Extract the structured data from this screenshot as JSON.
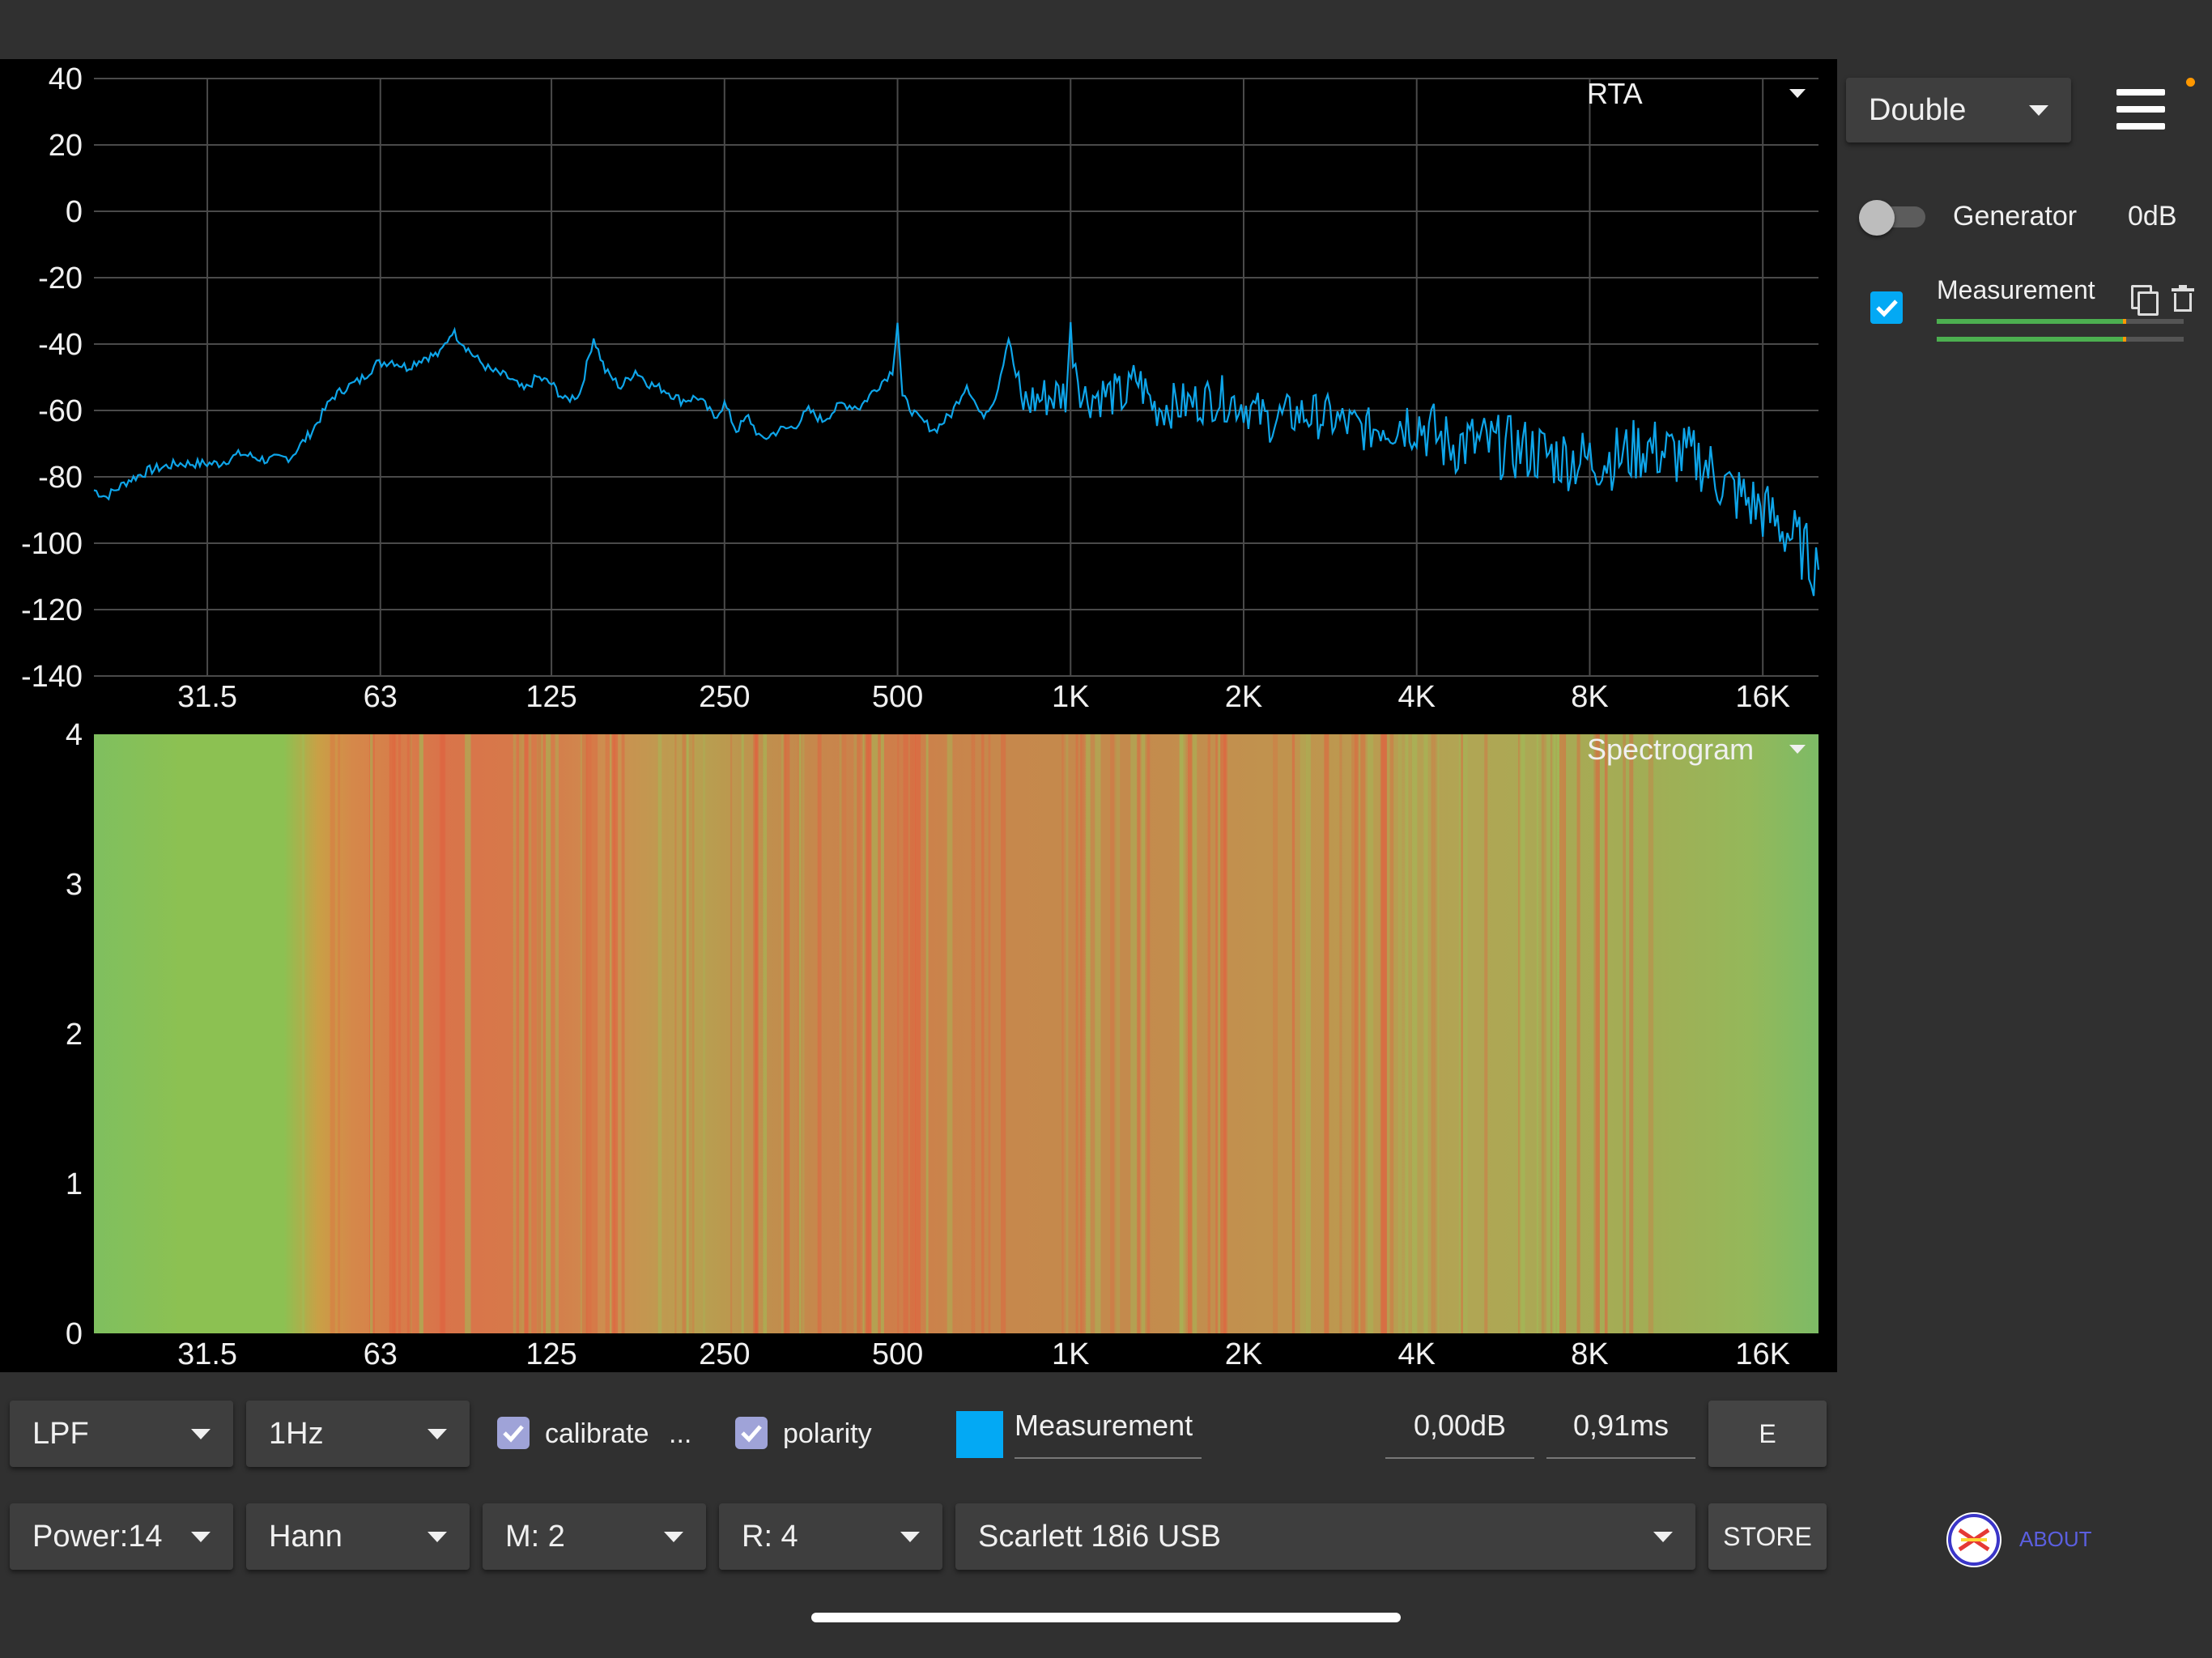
{
  "chart_data": [
    {
      "type": "line",
      "view_label": "RTA",
      "scale": "log-x",
      "x_ticks": [
        "31.5",
        "63",
        "125",
        "250",
        "500",
        "1K",
        "2K",
        "4K",
        "8K",
        "16K"
      ],
      "y_ticks": [
        "40",
        "20",
        "0",
        "-20",
        "-40",
        "-60",
        "-80",
        "-100",
        "-120",
        "-140"
      ],
      "ylim": [
        -140,
        40
      ],
      "xlim_hz": [
        20,
        20000
      ],
      "grid": true,
      "series": [
        {
          "color": "#0ea5e9",
          "points": [
            [
              20,
              -84
            ],
            [
              21,
              -86
            ],
            [
              23,
              -81
            ],
            [
              25,
              -78
            ],
            [
              28,
              -76
            ],
            [
              30,
              -76
            ],
            [
              33,
              -76
            ],
            [
              36,
              -73
            ],
            [
              40,
              -75
            ],
            [
              44,
              -74
            ],
            [
              48,
              -66
            ],
            [
              52,
              -56
            ],
            [
              55,
              -53
            ],
            [
              58,
              -51
            ],
            [
              62,
              -46
            ],
            [
              66,
              -45
            ],
            [
              70,
              -47
            ],
            [
              75,
              -44
            ],
            [
              80,
              -43
            ],
            [
              84,
              -36
            ],
            [
              88,
              -40
            ],
            [
              92,
              -44
            ],
            [
              98,
              -48
            ],
            [
              105,
              -50
            ],
            [
              112,
              -54
            ],
            [
              118,
              -50
            ],
            [
              125,
              -52
            ],
            [
              132,
              -57
            ],
            [
              140,
              -55
            ],
            [
              148,
              -38
            ],
            [
              155,
              -48
            ],
            [
              165,
              -53
            ],
            [
              175,
              -48
            ],
            [
              185,
              -52
            ],
            [
              198,
              -54
            ],
            [
              210,
              -57
            ],
            [
              225,
              -56
            ],
            [
              240,
              -62
            ],
            [
              250,
              -58
            ],
            [
              262,
              -66
            ],
            [
              275,
              -62
            ],
            [
              290,
              -69
            ],
            [
              310,
              -66
            ],
            [
              330,
              -65
            ],
            [
              350,
              -60
            ],
            [
              370,
              -63
            ],
            [
              400,
              -58
            ],
            [
              430,
              -59
            ],
            [
              460,
              -53
            ],
            [
              490,
              -48
            ],
            [
              500,
              -33
            ],
            [
              510,
              -56
            ],
            [
              540,
              -62
            ],
            [
              580,
              -66
            ],
            [
              620,
              -61
            ],
            [
              660,
              -52
            ],
            [
              700,
              -62
            ],
            [
              740,
              -56
            ],
            [
              780,
              -38
            ],
            [
              820,
              -58
            ],
            [
              900,
              -56
            ],
            [
              980,
              -55
            ],
            [
              1000,
              -37
            ],
            [
              1050,
              -56
            ],
            [
              1150,
              -55
            ],
            [
              1250,
              -56
            ],
            [
              1300,
              -50
            ],
            [
              1400,
              -59
            ],
            [
              1600,
              -58
            ],
            [
              1800,
              -56
            ],
            [
              2000,
              -58
            ],
            [
              2200,
              -63
            ],
            [
              2500,
              -61
            ],
            [
              2800,
              -62
            ],
            [
              3000,
              -64
            ],
            [
              3300,
              -66
            ],
            [
              3600,
              -63
            ],
            [
              4000,
              -63
            ],
            [
              4500,
              -70
            ],
            [
              5000,
              -70
            ],
            [
              5600,
              -71
            ],
            [
              6300,
              -72
            ],
            [
              7000,
              -74
            ],
            [
              8000,
              -75
            ],
            [
              9000,
              -74
            ],
            [
              10000,
              -71
            ],
            [
              11000,
              -73
            ],
            [
              12500,
              -75
            ],
            [
              14000,
              -84
            ],
            [
              16000,
              -90
            ],
            [
              18000,
              -98
            ],
            [
              20000,
              -108
            ]
          ]
        }
      ]
    },
    {
      "type": "heatmap",
      "view_label": "Spectrogram",
      "x_ticks": [
        "31.5",
        "63",
        "125",
        "250",
        "500",
        "1K",
        "2K",
        "4K",
        "8K",
        "16K"
      ],
      "y_ticks": [
        "4",
        "3",
        "2",
        "1",
        "0"
      ],
      "ylim": [
        0,
        4
      ]
    }
  ],
  "right_panel": {
    "mode_select": "Double",
    "generator_label": "Generator",
    "generator_level": "0dB",
    "measurement_label": "Measurement",
    "about_label": "ABOUT"
  },
  "bottom_row1": {
    "filter_select": "LPF",
    "resolution_select": "1Hz",
    "calibrate_label": "calibrate",
    "calibrate_more": "...",
    "polarity_label": "polarity",
    "measurement_name": "Measurement",
    "measurement_color": "#03a9f4",
    "gain_value": "0,00dB",
    "delay_value": "0,91ms",
    "e_button": "E"
  },
  "bottom_row2": {
    "power_select": "Power:14",
    "window_select": "Hann",
    "m_select": "M: 2",
    "r_select": "R: 4",
    "device_select": "Scarlett 18i6 USB",
    "store_button": "STORE"
  },
  "colors": {
    "background": "#303030",
    "plot_background": "#000000",
    "accent": "#03a9f4",
    "indicator": "#ff9800"
  }
}
